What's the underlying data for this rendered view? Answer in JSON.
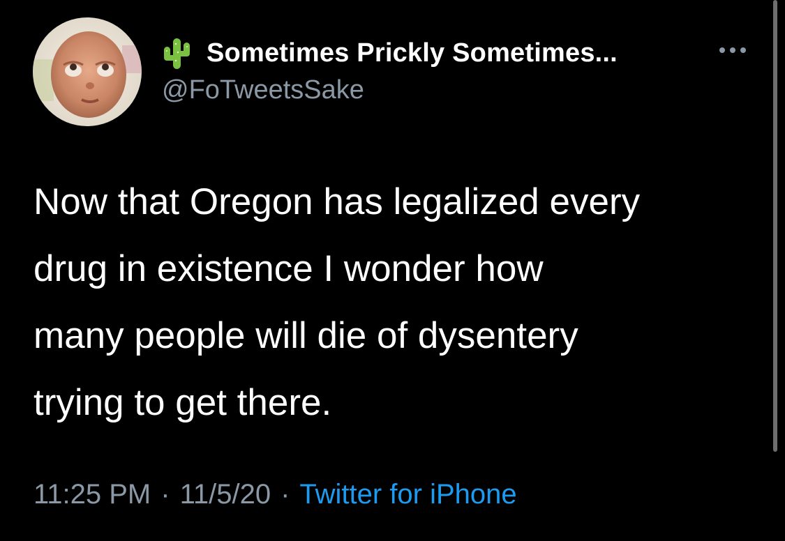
{
  "author": {
    "display_name": "Sometimes Prickly Sometimes...",
    "handle": "@FoTweetsSake",
    "avatar_icon": "baby-face-avatar",
    "name_emoji_icon": "cactus-icon"
  },
  "tweet": {
    "text": "Now that Oregon has legalized every\ndrug in existence I wonder how\nmany people will die of dysentery\ntrying to get there."
  },
  "meta": {
    "time": "11:25 PM",
    "date": "11/5/20",
    "separator": "·",
    "source": "Twitter for iPhone"
  },
  "icons": {
    "more": "more-options-icon"
  },
  "colors": {
    "background": "#000000",
    "text": "#ffffff",
    "secondary": "#8b98a5",
    "link": "#1d9bf0"
  }
}
